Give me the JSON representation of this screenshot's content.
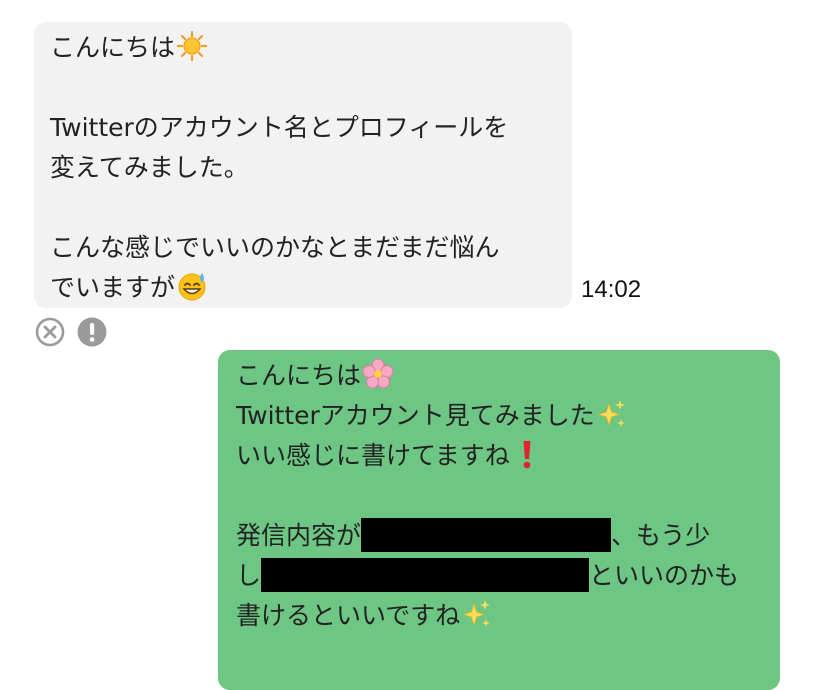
{
  "received_message": {
    "line1": "こんにちは",
    "line1_emoji": "sun-icon",
    "line2": "Twitterのアカウント名とプロフィールを",
    "line3": "変えてみました。",
    "line4": "こんな感じでいいのかなとまだまだ悩ん",
    "line5": "でいますが",
    "line5_emoji": "sweat-smile-icon",
    "time": "14:02"
  },
  "status": {
    "cancel_icon": "circle-x-icon",
    "warning_icon": "exclamation-circle-icon"
  },
  "sent_message": {
    "line1": "こんにちは",
    "line1_emoji": "cherry-blossom-icon",
    "line2": "Twitterアカウント見てみました",
    "line2_emoji": "sparkles-icon",
    "line3": "いい感じに書けてますね",
    "line3_emoji": "red-exclamation-icon",
    "line4_a": "発信内容が",
    "line4_b": "、もう少",
    "line5_a": "し",
    "line5_b": "といいのかも",
    "line6": "書けるといいですね",
    "line6_emoji": "sparkles-icon"
  },
  "colors": {
    "received_bubble": "#f3f2f3",
    "sent_bubble": "#6dc683",
    "status_icon": "#9a9a9a"
  }
}
